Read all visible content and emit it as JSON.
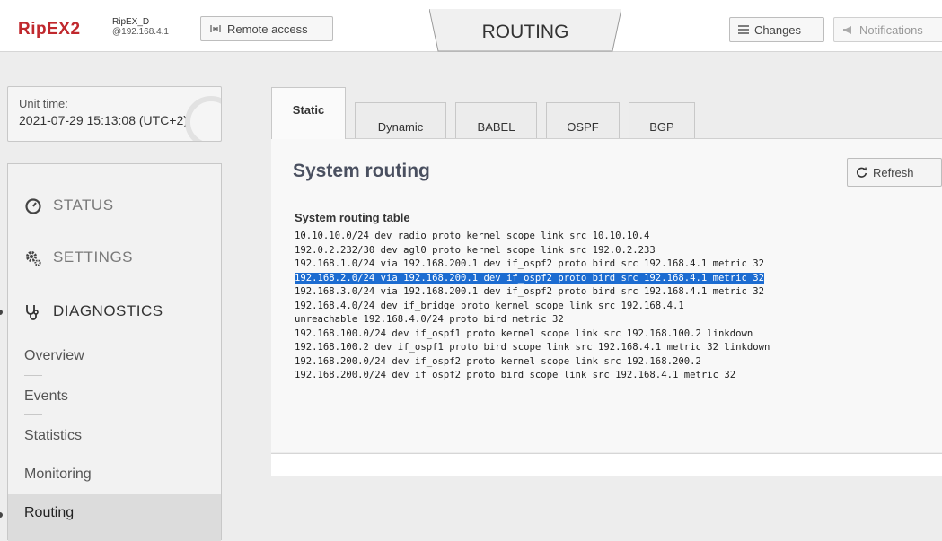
{
  "header": {
    "logo": "RipEX2",
    "device_name": "RipEX_D",
    "device_ip": "@192.168.4.1",
    "remote_access_label": "Remote access",
    "page_title": "ROUTING",
    "changes_label": "Changes",
    "notifications_label": "Notifications"
  },
  "unit_time": {
    "label": "Unit time:",
    "value": "2021-07-29 15:13:08 (UTC+2)"
  },
  "nav": {
    "status": "STATUS",
    "settings": "SETTINGS",
    "diagnostics": "DIAGNOSTICS",
    "sub_items": [
      "Overview",
      "Events",
      "Statistics",
      "Monitoring",
      "Routing"
    ]
  },
  "tabs": [
    "Static",
    "Dynamic",
    "BABEL",
    "OSPF",
    "BGP"
  ],
  "main": {
    "title": "System routing",
    "refresh_label": "Refresh",
    "table_caption": "System routing table",
    "routes": [
      "10.10.10.0/24 dev radio proto kernel scope link src 10.10.10.4",
      "192.0.2.232/30 dev agl0 proto kernel scope link src 192.0.2.233",
      "192.168.1.0/24 via 192.168.200.1 dev if_ospf2 proto bird src 192.168.4.1 metric 32",
      "192.168.2.0/24 via 192.168.200.1 dev if_ospf2 proto bird src 192.168.4.1 metric 32",
      "192.168.3.0/24 via 192.168.200.1 dev if_ospf2 proto bird src 192.168.4.1 metric 32",
      "192.168.4.0/24 dev if_bridge proto kernel scope link src 192.168.4.1",
      "unreachable 192.168.4.0/24 proto bird metric 32",
      "192.168.100.0/24 dev if_ospf1 proto kernel scope link src 192.168.100.2 linkdown",
      "192.168.100.2 dev if_ospf1 proto bird scope link src 192.168.4.1 metric 32 linkdown",
      "192.168.200.0/24 dev if_ospf2 proto kernel scope link src 192.168.200.2",
      "192.168.200.0/24 dev if_ospf2 proto bird scope link src 192.168.4.1 metric 32"
    ],
    "selected_route_index": 3
  },
  "colors": {
    "brand": "#c0282d",
    "selection": "#1c6cd1"
  }
}
